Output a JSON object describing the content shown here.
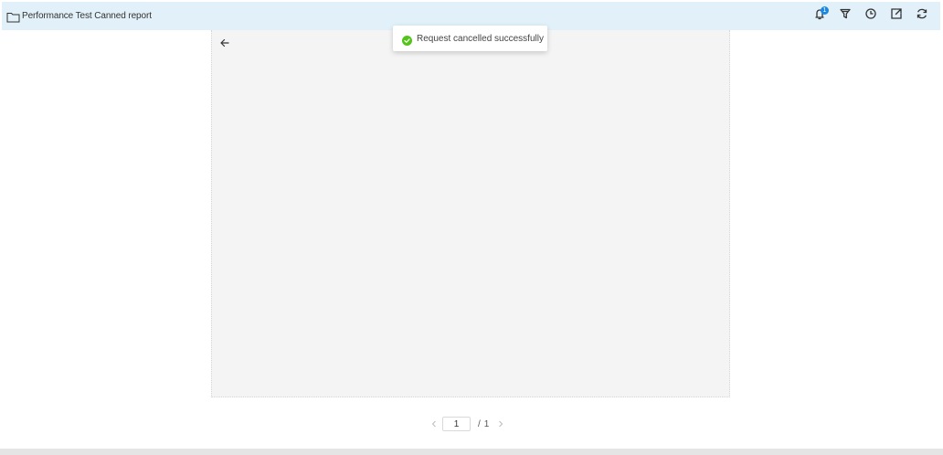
{
  "header": {
    "report_title": "Performance Test Canned report",
    "notification_count": "1",
    "toolbar_icons": [
      "bell-icon",
      "filter-icon",
      "schedule-icon",
      "export-icon",
      "refresh-icon"
    ]
  },
  "toast": {
    "message": "Request cancelled successfully",
    "status": "success",
    "color": "#52c41a"
  },
  "pagination": {
    "current_page": "1",
    "separator": "/",
    "total_pages": "1"
  },
  "colors": {
    "header_bg": "#e1f0f9",
    "canvas_bg": "#f4f4f4",
    "badge": "#1a88e0"
  }
}
